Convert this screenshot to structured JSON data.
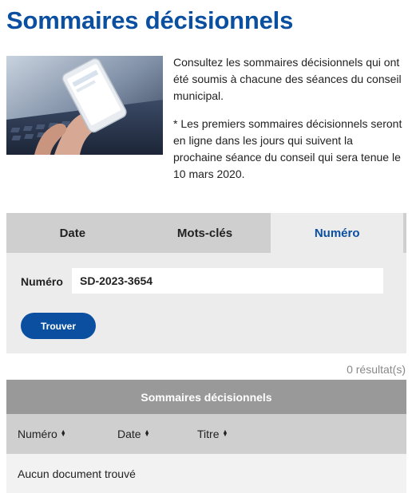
{
  "page": {
    "title": "Sommaires décisionnels"
  },
  "intro": {
    "paragraph_1": "Consultez les sommaires décisionnels qui ont été soumis à chacune des séances du conseil municipal.",
    "paragraph_2": "* Les premiers sommaires décisionnels seront en ligne dans les jours qui suivent la prochaine séance du conseil qui sera tenue le 10 mars 2020."
  },
  "tabs": [
    {
      "label": "Date"
    },
    {
      "label": "Mots-clés"
    },
    {
      "label": "Numéro",
      "active": true
    }
  ],
  "search": {
    "field_label": "Numéro",
    "field_value": "SD-2023-3654",
    "button_label": "Trouver"
  },
  "results": {
    "count_text": "0 résultat(s)",
    "title": "Sommaires décisionnels",
    "columns": [
      {
        "label": "Numéro",
        "icon": "sort-icon"
      },
      {
        "label": "Date",
        "icon": "sort-icon"
      },
      {
        "label": "Titre",
        "icon": "sort-icon"
      }
    ],
    "empty_message": "Aucun document trouvé"
  },
  "colors": {
    "accent": "#0b4fa0",
    "tab_bar": "#cfcfcf",
    "panel": "#ececec",
    "results_header": "#999999"
  }
}
